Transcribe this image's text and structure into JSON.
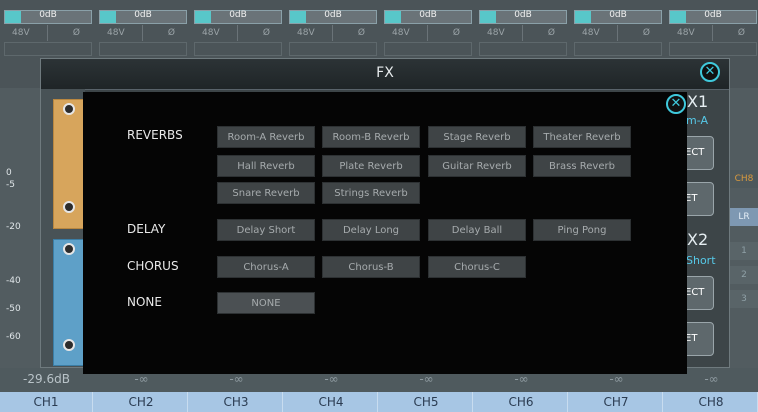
{
  "mixer": {
    "channels": [
      {
        "gain": "0dB",
        "p48": "48V",
        "phase": "Ø",
        "level": "-29.6dB",
        "label": "CH1"
      },
      {
        "gain": "0dB",
        "p48": "48V",
        "phase": "Ø",
        "level": "-∞",
        "label": "CH2"
      },
      {
        "gain": "0dB",
        "p48": "48V",
        "phase": "Ø",
        "level": "-∞",
        "label": "CH3"
      },
      {
        "gain": "0dB",
        "p48": "48V",
        "phase": "Ø",
        "level": "-∞",
        "label": "CH4"
      },
      {
        "gain": "0dB",
        "p48": "48V",
        "phase": "Ø",
        "level": "-∞",
        "label": "CH5"
      },
      {
        "gain": "0dB",
        "p48": "48V",
        "phase": "Ø",
        "level": "-∞",
        "label": "CH6"
      },
      {
        "gain": "0dB",
        "p48": "48V",
        "phase": "Ø",
        "level": "-∞",
        "label": "CH7"
      },
      {
        "gain": "0dB",
        "p48": "48V",
        "phase": "Ø",
        "level": "-∞",
        "label": "CH8"
      }
    ],
    "scale": [
      "0",
      "-5",
      "-20",
      "-40",
      "-50",
      "-60"
    ],
    "right_tags": {
      "ch8": "CH8",
      "lr": "LR",
      "one": "1",
      "two": "2",
      "three": "3"
    }
  },
  "fx_window": {
    "title": "FX",
    "fx1_label": "X1",
    "fx1_preset": "m-A",
    "fx2_label": "X2",
    "fx2_preset": "Short",
    "select_label": "ECT",
    "reset_label": "ET",
    "close_glyph": "✕"
  },
  "modal": {
    "close_glyph": "✕",
    "categories": [
      {
        "name": "REVERBS",
        "presets": [
          "Room-A Reverb",
          "Room-B Reverb",
          "Stage Reverb",
          "Theater Reverb",
          "Hall Reverb",
          "Plate Reverb",
          "Guitar Reverb",
          "Brass Reverb",
          "Snare Reverb",
          "Strings Reverb"
        ]
      },
      {
        "name": "DELAY",
        "presets": [
          "Delay Short",
          "Delay Long",
          "Delay Ball",
          "Ping Pong"
        ]
      },
      {
        "name": "CHORUS",
        "presets": [
          "Chorus-A",
          "Chorus-B",
          "Chorus-C"
        ]
      },
      {
        "name": "NONE",
        "presets": [
          "NONE"
        ]
      }
    ]
  },
  "colors": {
    "accent": "#3fc9dc",
    "channel_bar": "#a7c6e4",
    "button": "#3f4446",
    "modal_bg": "#050505"
  }
}
